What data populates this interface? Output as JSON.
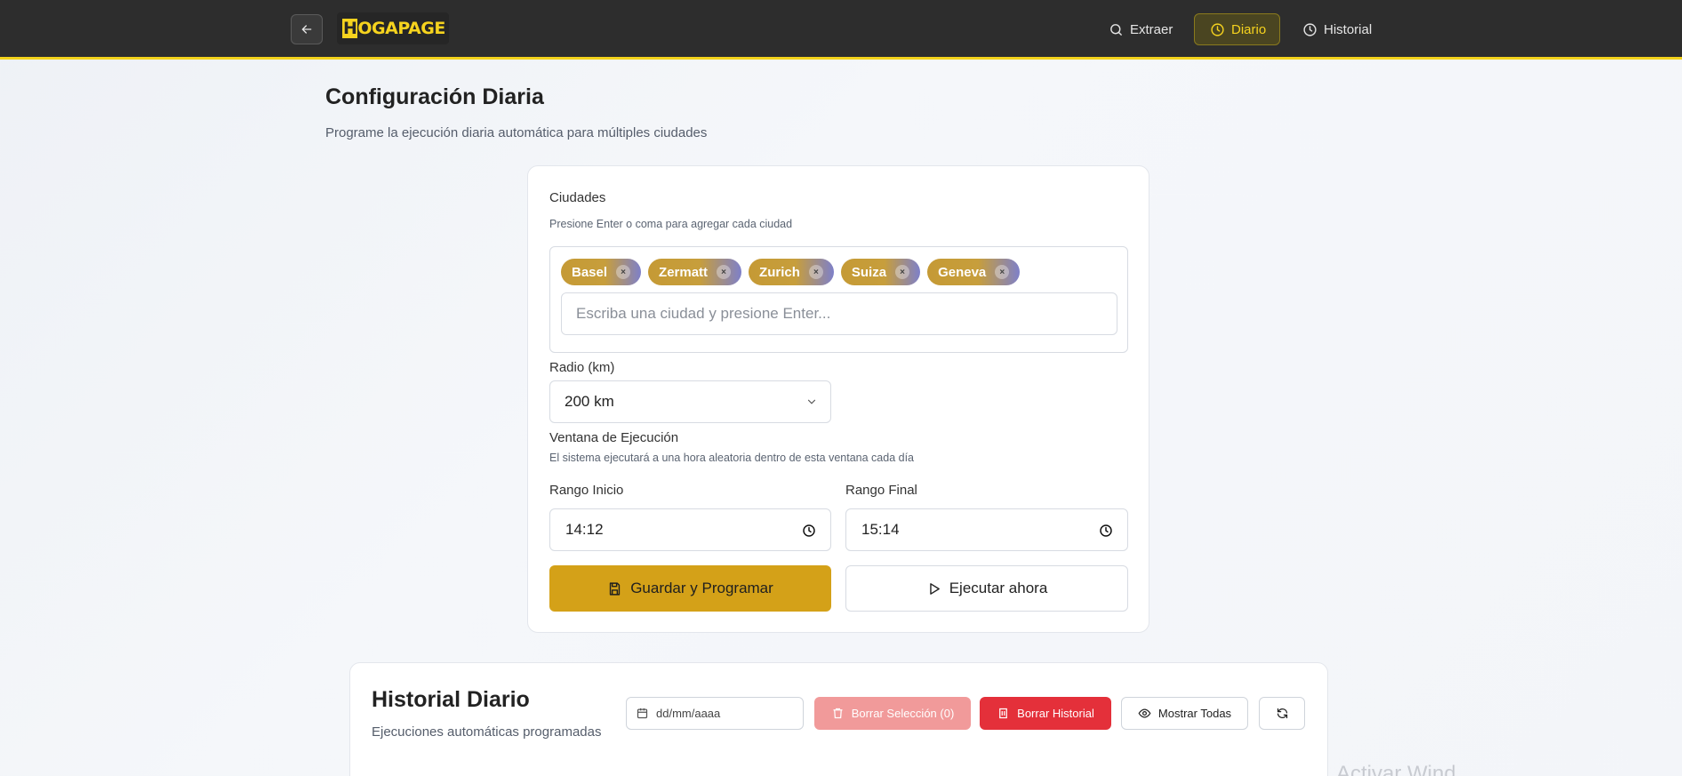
{
  "header": {
    "logo_text": "HOGAPAGE",
    "nav": {
      "extraer": "Extraer",
      "diario": "Diario",
      "historial": "Historial"
    },
    "active_tab": "Diario",
    "accent_color": "#f2d21b"
  },
  "page": {
    "title": "Configuración Diaria",
    "subtitle": "Programe la ejecución diaria automática para múltiples ciudades"
  },
  "config": {
    "cities_label": "Ciudades",
    "cities_hint": "Presione Enter o coma para agregar cada ciudad",
    "cities": [
      "Basel",
      "Zermatt",
      "Zurich",
      "Suiza",
      "Geneva"
    ],
    "chip_remove": "×",
    "city_placeholder": "Escriba una ciudad y presione Enter...",
    "radius_label": "Radio (km)",
    "radius_value": "200 km",
    "window_label": "Ventana de Ejecución",
    "window_hint": "El sistema ejecutará a una hora aleatoria dentro de esta ventana cada día",
    "start_label": "Rango Inicio",
    "start_value": "14:12",
    "end_label": "Rango Final",
    "end_value": "15:14",
    "save_button": "Guardar y Programar",
    "run_button": "Ejecutar ahora",
    "save_color": "#d4a118"
  },
  "history": {
    "title": "Historial Diario",
    "subtitle": "Ejecuciones automáticas programadas",
    "date_placeholder": "dd/mm/aaaa",
    "delete_selection": "Borrar Selección (0)",
    "delete_history": "Borrar Historial",
    "show_all": "Mostrar Todas"
  },
  "watermark": "Activar Wind"
}
